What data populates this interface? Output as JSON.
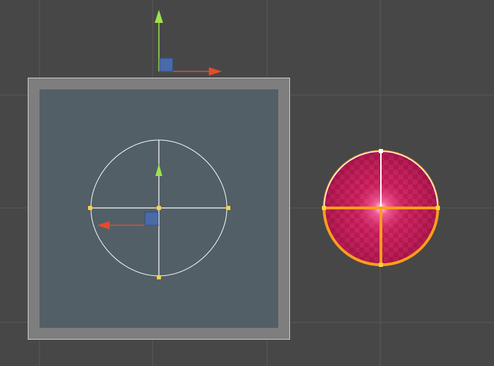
{
  "viewport": {
    "background": "#474747",
    "grid_color": "#5a5a5a"
  },
  "colors": {
    "axis_y": "#9be34b",
    "axis_x": "#e64b2a",
    "plane_handle": "#4a6aa8",
    "panel_frame": "#7e7e7e",
    "panel_inner": "#525f66",
    "panel_border": "#cfcfcf",
    "gizmo_outline": "#ffffff",
    "control_point": "#ffd046",
    "sphere_base": "#c2185b",
    "sphere_outline": "#ff9e1b",
    "sphere_cross": "#ff9e1b",
    "sphere_cross_white": "#ffffff"
  },
  "icons": {
    "top_gizmo_y": "arrow-up-icon",
    "top_gizmo_x": "arrow-right-icon",
    "inner_gizmo_y": "arrow-up-icon",
    "inner_gizmo_x": "arrow-left-icon"
  }
}
